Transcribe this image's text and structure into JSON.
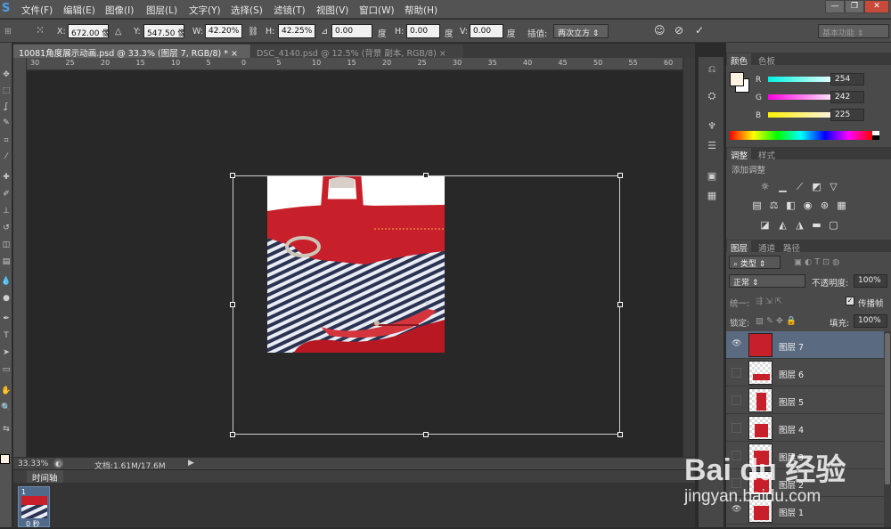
{
  "app": {
    "logo": "S",
    "menu": [
      "文件(F)",
      "编辑(E)",
      "图像(I)",
      "图层(L)",
      "文字(Y)",
      "选择(S)",
      "滤镜(T)",
      "视图(V)",
      "窗口(W)",
      "帮助(H)"
    ]
  },
  "options": {
    "x_label": "X:",
    "x_value": "672.00 像素",
    "y_label": "Y:",
    "y_value": "547.50 像素",
    "w_label": "W:",
    "w_value": "42.20%",
    "h_label": "H:",
    "h_value": "42.25%",
    "angle_value": "0.00",
    "angle_unit": "度",
    "hskew_label": "H:",
    "hskew_value": "0.00",
    "hskew_unit": "度",
    "vskew_label": "V:",
    "vskew_value": "0.00",
    "vskew_unit": "度",
    "interp_label": "插值:",
    "interp_value": "两次立方",
    "workspace": "基本功能"
  },
  "tabs": [
    {
      "label": "10081角度展示动画.psd @ 33.3% (图层 7, RGB/8) *",
      "active": true
    },
    {
      "label": "DSC_4140.psd @ 12.5% (背景 副本, RGB/8)",
      "active": false
    }
  ],
  "ruler": {
    "h_ticks": [
      "30",
      "25",
      "20",
      "15",
      "10",
      "5",
      "0",
      "5",
      "10",
      "15",
      "20",
      "25",
      "30",
      "35",
      "40",
      "45",
      "50",
      "55",
      "60"
    ]
  },
  "status": {
    "zoom": "33.33%",
    "doc_info": "文档:1.61M/17.6M"
  },
  "timeline": {
    "title": "时间轴",
    "frame_number": "1",
    "frame_delay": "0 秒"
  },
  "color_panel": {
    "tabs": [
      "颜色",
      "色板"
    ],
    "r_label": "R",
    "r_value": "254",
    "g_label": "G",
    "g_value": "242",
    "b_label": "B",
    "b_value": "225",
    "fg_color": "#fef2e1"
  },
  "adjust_panel": {
    "tabs": [
      "调整",
      "样式"
    ],
    "title": "添加调整"
  },
  "layers_panel": {
    "tabs": [
      "图层",
      "通道",
      "路径"
    ],
    "filter_label": "类型",
    "blend_mode": "正常",
    "opacity_label": "不透明度:",
    "opacity_value": "100%",
    "unify_label": "统一:",
    "propagate_label": "传播帧",
    "lock_label": "锁定:",
    "fill_label": "填充:",
    "fill_value": "100%",
    "layers": [
      {
        "name": "图层 7",
        "visible": true,
        "selected": true
      },
      {
        "name": "图层 6",
        "visible": false,
        "selected": false
      },
      {
        "name": "图层 5",
        "visible": false,
        "selected": false
      },
      {
        "name": "图层 4",
        "visible": false,
        "selected": false
      },
      {
        "name": "图层 3",
        "visible": false,
        "selected": false
      },
      {
        "name": "图层 2",
        "visible": false,
        "selected": false
      },
      {
        "name": "图层 1",
        "visible": true,
        "selected": false
      }
    ]
  },
  "watermark": {
    "brand": "Bai du 经验",
    "url": "jingyan.baidu.com"
  },
  "colors": {
    "accent_blue": "#4a9fe8",
    "bag_red": "#c8202a",
    "selection_blue": "#5a6a80"
  }
}
